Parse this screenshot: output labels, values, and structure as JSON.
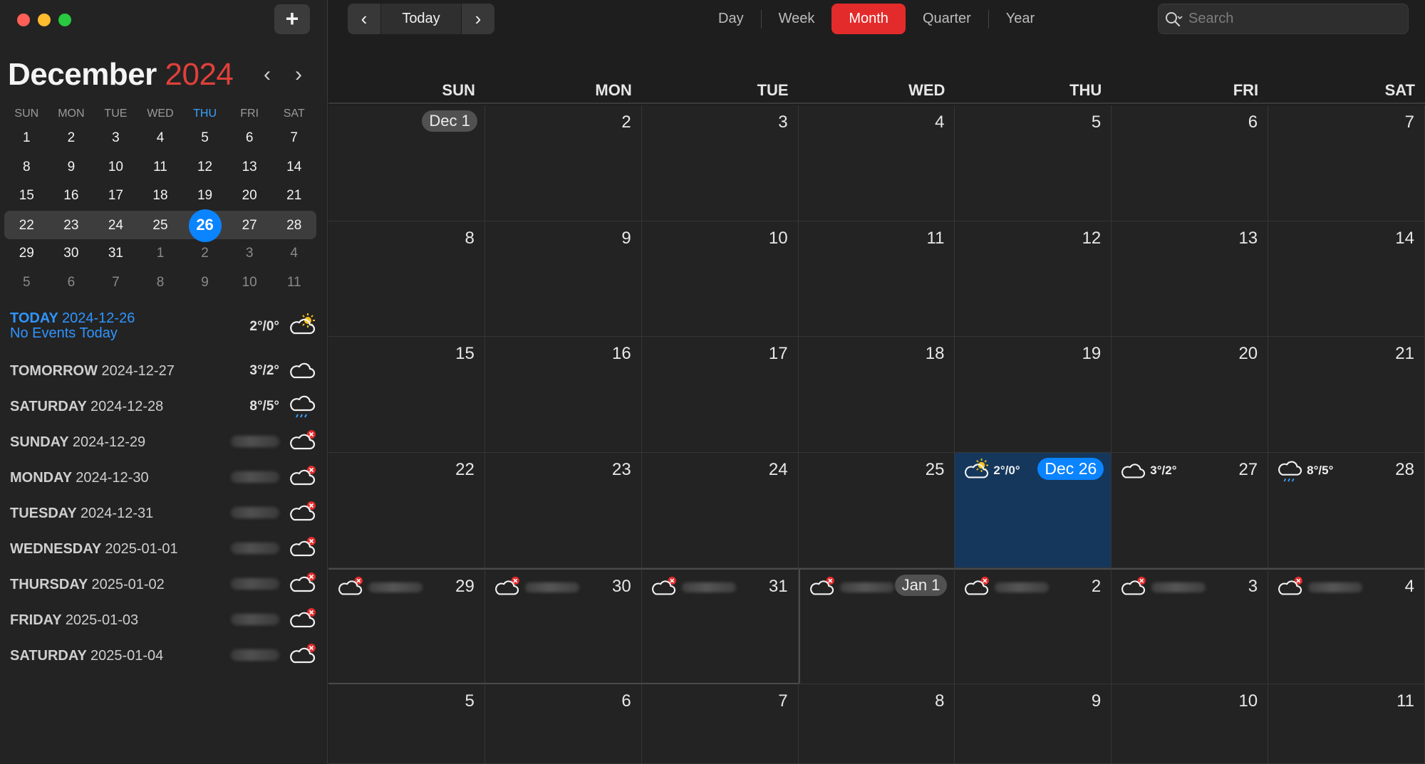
{
  "sidebar": {
    "add_label": "+",
    "month": "December",
    "year": "2024",
    "prev_icon": "chevron-left-icon",
    "next_icon": "chevron-right-icon",
    "weekdays": [
      "SUN",
      "MON",
      "TUE",
      "WED",
      "THU",
      "FRI",
      "SAT"
    ],
    "weeks": [
      [
        "1",
        "2",
        "3",
        "4",
        "5",
        "6",
        "7"
      ],
      [
        "8",
        "9",
        "10",
        "11",
        "12",
        "13",
        "14"
      ],
      [
        "15",
        "16",
        "17",
        "18",
        "19",
        "20",
        "21"
      ],
      [
        "22",
        "23",
        "24",
        "25",
        "26",
        "27",
        "28"
      ],
      [
        "29",
        "30",
        "31",
        "1",
        "2",
        "3",
        "4"
      ],
      [
        "5",
        "6",
        "7",
        "8",
        "9",
        "10",
        "11"
      ]
    ],
    "agenda": [
      {
        "day": "TODAY",
        "date": "2024-12-26",
        "sub": "No Events Today",
        "temp": "2°/0°",
        "icon": "cloud-sun-icon"
      },
      {
        "day": "TOMORROW",
        "date": "2024-12-27",
        "temp": "3°/2°",
        "icon": "cloud-icon"
      },
      {
        "day": "SATURDAY",
        "date": "2024-12-28",
        "temp": "8°/5°",
        "icon": "cloud-rain-icon"
      },
      {
        "day": "SUNDAY",
        "date": "2024-12-29",
        "icon": "cloud-unavailable-icon"
      },
      {
        "day": "MONDAY",
        "date": "2024-12-30",
        "icon": "cloud-unavailable-icon"
      },
      {
        "day": "TUESDAY",
        "date": "2024-12-31",
        "icon": "cloud-unavailable-icon"
      },
      {
        "day": "WEDNESDAY",
        "date": "2025-01-01",
        "icon": "cloud-unavailable-icon"
      },
      {
        "day": "THURSDAY",
        "date": "2025-01-02",
        "icon": "cloud-unavailable-icon"
      },
      {
        "day": "FRIDAY",
        "date": "2025-01-03",
        "icon": "cloud-unavailable-icon"
      },
      {
        "day": "SATURDAY",
        "date": "2025-01-04",
        "icon": "cloud-unavailable-icon"
      }
    ]
  },
  "toolbar": {
    "today_label": "Today",
    "views": [
      "Day",
      "Week",
      "Month",
      "Quarter",
      "Year"
    ],
    "active_view": "Month",
    "search_placeholder": "Search"
  },
  "calendar": {
    "weekdays": [
      "SUN",
      "MON",
      "TUE",
      "WED",
      "THU",
      "FRI",
      "SAT"
    ],
    "weeks": [
      [
        "Dec 1",
        "2",
        "3",
        "4",
        "5",
        "6",
        "7"
      ],
      [
        "8",
        "9",
        "10",
        "11",
        "12",
        "13",
        "14"
      ],
      [
        "15",
        "16",
        "17",
        "18",
        "19",
        "20",
        "21"
      ],
      [
        "22",
        "23",
        "24",
        "25",
        "Dec 26",
        "27",
        "28"
      ],
      [
        "29",
        "30",
        "31",
        "Jan 1",
        "2",
        "3",
        "4"
      ],
      [
        "5",
        "6",
        "7",
        "8",
        "9",
        "10",
        "11"
      ]
    ],
    "weather": {
      "Dec 26": {
        "temp": "2°/0°",
        "icon": "cloud-sun-icon"
      },
      "27": {
        "temp": "3°/2°",
        "icon": "cloud-icon"
      },
      "28": {
        "temp": "8°/5°",
        "icon": "cloud-rain-icon"
      }
    },
    "colors": {
      "accent": "#0a84ff",
      "active_view": "#e32b2b",
      "year": "#e0403a",
      "today_cell": "#15375c"
    }
  }
}
